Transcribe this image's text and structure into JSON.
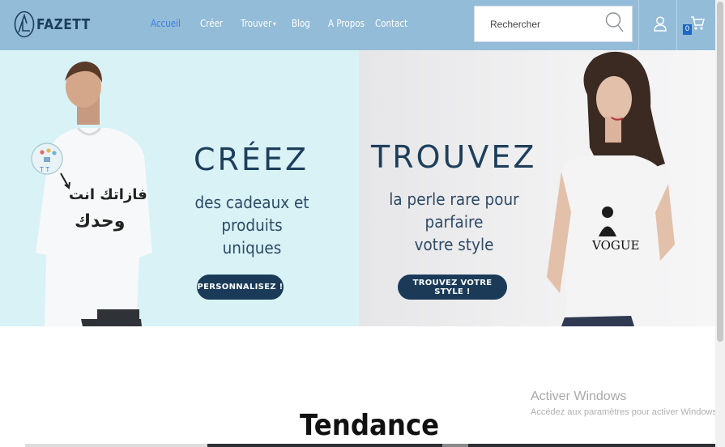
{
  "brand": {
    "name": "FAZETT"
  },
  "nav": [
    {
      "label": "Accueil",
      "active": true
    },
    {
      "label": "Créer",
      "active": false
    },
    {
      "label": "Trouver",
      "active": false,
      "has_dropdown": true
    },
    {
      "label": "Blog",
      "active": false
    },
    {
      "label": "A Propos",
      "active": false
    },
    {
      "label": "Contact",
      "active": false
    }
  ],
  "search": {
    "placeholder": "Rechercher",
    "value": ""
  },
  "cart": {
    "count": "0"
  },
  "hero": {
    "left": {
      "title": "CRÉEZ",
      "subtitle": "des cadeaux et produits\nuniques",
      "button": "PERSONNALISEZ !",
      "tshirt_text_line1": "فازاتك انت",
      "tshirt_text_line2": "وحدك"
    },
    "right": {
      "title": "TROUVEZ",
      "subtitle": "la perle rare pour parfaire\nvotre style",
      "button": "TROUVEZ VOTRE STYLE !",
      "tshirt_print": "VOGUE"
    }
  },
  "section": {
    "title": "Tendance"
  },
  "watermark": {
    "title": "Activer Windows",
    "subtitle": "Accédez aux paramètres pour activer Windows."
  },
  "colors": {
    "header_bg": "#93bcd8",
    "brand_dark": "#1a3a58",
    "active_link": "#3a7ee6",
    "hero_left_bg": "#d8f2f6",
    "cart_badge": "#1e66c8"
  },
  "icons": [
    "logo-mark-icon",
    "search-icon",
    "user-icon",
    "cart-icon",
    "chevron-down-icon"
  ]
}
